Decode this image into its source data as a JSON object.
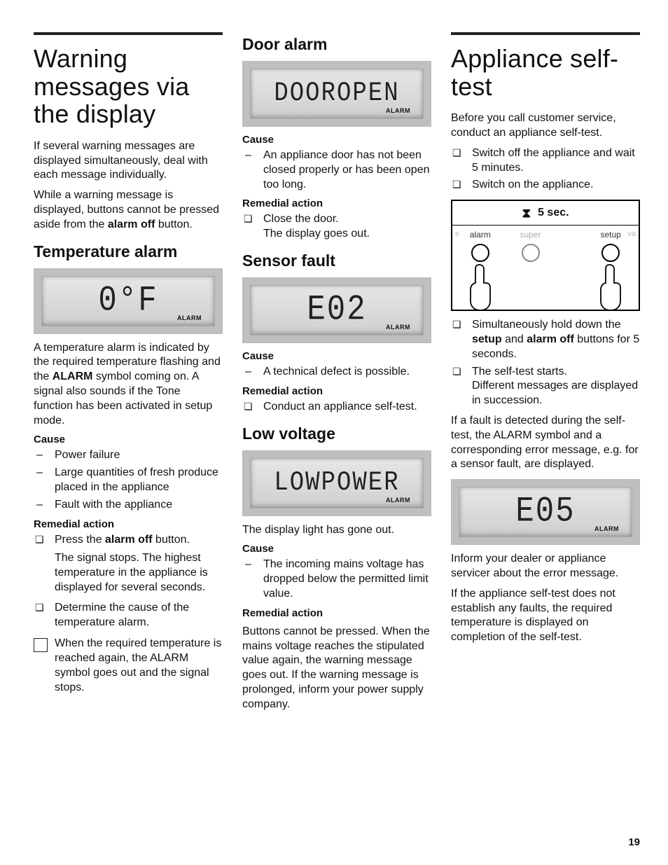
{
  "pageNumber": "19",
  "col1": {
    "h1": "Warning messages via the display",
    "intro1": "If several warning messages are displayed simultaneously, deal with each message individually.",
    "intro2_a": "While a warning message is displayed, buttons cannot be pressed aside from the ",
    "intro2_bold": "alarm off",
    "intro2_b": " button.",
    "temp_h2": "Temperature alarm",
    "temp_lcd": "0°F",
    "alarm_label": "ALARM",
    "temp_desc_a": "A temperature alarm is indicated by the required temperature flashing and the ",
    "temp_desc_bold": "ALARM",
    "temp_desc_b": " symbol coming on. A signal also sounds if the Tone function has been activated in setup mode.",
    "cause_label": "Cause",
    "temp_causes": [
      "Power failure",
      "Large quantities of fresh produce placed in the appliance",
      "Fault with the appliance"
    ],
    "remedial_label": "Remedial action",
    "temp_rem1_a": "Press the ",
    "temp_rem1_bold": "alarm off",
    "temp_rem1_b": " button.",
    "temp_rem1_extra": "The signal stops. The highest temperature in the appliance is displayed for several seconds.",
    "temp_rem2": "Determine the cause of the temperature alarm.",
    "temp_note": "When the required temperature is reached again, the ALARM symbol goes out and the signal stops."
  },
  "col2": {
    "door_h2": "Door alarm",
    "door_lcd": "DOOROPEN",
    "door_cause": "An appliance door has not been closed properly or has been open too long.",
    "door_rem_a": "Close the door.",
    "door_rem_b": "The display goes out.",
    "sensor_h2": "Sensor fault",
    "sensor_lcd": "E02",
    "sensor_cause": "A technical defect is possible.",
    "sensor_rem": "Conduct an appliance self-test.",
    "low_h2": "Low voltage",
    "low_lcd": "LOWPOWER",
    "low_intro": "The display light has gone out.",
    "low_cause": "The incoming mains voltage has dropped below the permitted limit value.",
    "low_rem": "Buttons cannot be pressed. When the mains voltage reaches the stipulated value again, the warning message goes out. If the warning message is prolonged, inform your power supply company."
  },
  "col3": {
    "h1": "Appliance self-test",
    "intro": "Before you call customer service, conduct an appliance self-test.",
    "steps": [
      "Switch off the appliance and wait 5 minutes.",
      "Switch on the appliance."
    ],
    "illus": {
      "timer": "5 sec.",
      "labels": {
        "alarm": "alarm",
        "super": "super",
        "setup": "setup",
        "left_edge": "e",
        "right_edge": "va"
      }
    },
    "step3_a": "Simultaneously hold down the ",
    "step3_bold1": "setup",
    "step3_mid": " and ",
    "step3_bold2": "alarm off",
    "step3_b": " buttons for 5 seconds.",
    "step4_a": "The self-test starts.",
    "step4_b": "Different messages are displayed in succession.",
    "para1": "If a fault is detected during the self-test, the ALARM symbol and a corresponding error message, e.g. for a sensor fault, are displayed.",
    "result_lcd": "E05",
    "para2": "Inform your dealer or appliance servicer about the error message.",
    "para3": "If the appliance self-test does not establish any faults, the required temperature is displayed on completion of the self-test."
  }
}
